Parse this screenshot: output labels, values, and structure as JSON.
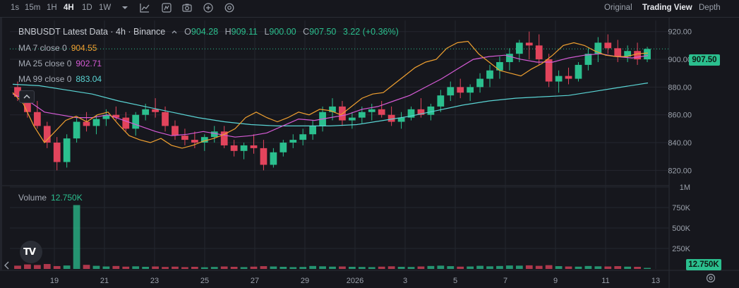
{
  "toolbar": {
    "timeframes": [
      {
        "label": "1s",
        "active": false
      },
      {
        "label": "15m",
        "active": false
      },
      {
        "label": "1H",
        "active": false
      },
      {
        "label": "4H",
        "active": true
      },
      {
        "label": "1D",
        "active": false
      },
      {
        "label": "1W",
        "active": false
      }
    ],
    "icons": [
      "chevron-down-icon",
      "chart-type-icon",
      "indicators-icon",
      "camera-icon",
      "plus-circle-icon",
      "settings-icon"
    ],
    "views": [
      {
        "label": "Original",
        "active": false
      },
      {
        "label": "Trading View",
        "active": true
      },
      {
        "label": "Depth",
        "active": false
      }
    ]
  },
  "header": {
    "pair": "BNBUSDT Latest Data · 4h · Binance",
    "open_label": "O",
    "open": "904.28",
    "high_label": "H",
    "high": "909.11",
    "low_label": "L",
    "low": "900.00",
    "close_label": "C",
    "close": "907.50",
    "change": "3.22 (+0.36%)"
  },
  "indicators": [
    {
      "label": "MA 7 close 0",
      "value": "904.55",
      "color": "#f0a030"
    },
    {
      "label": "MA 25 close 0",
      "value": "902.71",
      "color": "#d65bd6"
    },
    {
      "label": "MA 99 close 0",
      "value": "883.04",
      "color": "#5ad4d4"
    }
  ],
  "volume": {
    "label": "Volume",
    "value": "12.750K",
    "badge": "12.750K"
  },
  "last_price_badge": "907.50",
  "colors": {
    "up": "#2bbf8e",
    "down": "#e2445c",
    "ma7": "#f0a030",
    "ma25": "#d65bd6",
    "ma99": "#5ad4d4",
    "background": "#16171d",
    "grid": "#24272f"
  },
  "chart_data": {
    "type": "candlestick",
    "price_axis_ticks": [
      "920.00",
      "900.00",
      "880.00",
      "860.00",
      "840.00",
      "820.00"
    ],
    "price_ylim": [
      810,
      928
    ],
    "volume_axis_ticks": [
      "1M",
      "750K",
      "500K",
      "250K"
    ],
    "volume_ylim": [
      0,
      1000000
    ],
    "time_axis_ticks": [
      "19",
      "21",
      "23",
      "25",
      "27",
      "29",
      "2026",
      "3",
      "5",
      "7",
      "9",
      "11",
      "13"
    ],
    "ma99_points": [
      [
        0,
        882
      ],
      [
        10,
        881
      ],
      [
        20,
        878
      ],
      [
        30,
        875
      ],
      [
        40,
        870
      ],
      [
        50,
        866
      ],
      [
        60,
        862
      ],
      [
        70,
        858
      ],
      [
        80,
        855
      ],
      [
        90,
        853
      ],
      [
        100,
        852
      ],
      [
        110,
        852
      ],
      [
        120,
        852
      ],
      [
        130,
        853
      ],
      [
        140,
        856
      ],
      [
        150,
        859
      ],
      [
        160,
        863
      ],
      [
        170,
        867
      ],
      [
        180,
        870
      ],
      [
        190,
        872
      ],
      [
        200,
        873
      ],
      [
        210,
        874
      ],
      [
        220,
        877
      ],
      [
        230,
        880
      ],
      [
        240,
        883
      ]
    ],
    "ma25_points": [
      [
        0,
        875
      ],
      [
        6,
        870
      ],
      [
        12,
        862
      ],
      [
        18,
        860
      ],
      [
        24,
        858
      ],
      [
        30,
        858
      ],
      [
        36,
        860
      ],
      [
        42,
        856
      ],
      [
        48,
        852
      ],
      [
        54,
        848
      ],
      [
        60,
        845
      ],
      [
        66,
        846
      ],
      [
        72,
        848
      ],
      [
        78,
        846
      ],
      [
        84,
        844
      ],
      [
        90,
        845
      ],
      [
        96,
        847
      ],
      [
        102,
        852
      ],
      [
        108,
        857
      ],
      [
        114,
        856
      ],
      [
        120,
        858
      ],
      [
        126,
        860
      ],
      [
        132,
        864
      ],
      [
        138,
        866
      ],
      [
        144,
        870
      ],
      [
        150,
        874
      ],
      [
        156,
        880
      ],
      [
        162,
        886
      ],
      [
        168,
        893
      ],
      [
        174,
        900
      ],
      [
        180,
        902
      ],
      [
        186,
        903
      ],
      [
        192,
        900
      ],
      [
        198,
        898
      ],
      [
        204,
        898
      ],
      [
        210,
        901
      ],
      [
        216,
        903
      ],
      [
        222,
        904
      ],
      [
        228,
        902
      ],
      [
        234,
        901
      ],
      [
        240,
        902.7
      ]
    ],
    "ma7_points": [
      [
        0,
        876
      ],
      [
        4,
        868
      ],
      [
        8,
        852
      ],
      [
        12,
        840
      ],
      [
        16,
        848
      ],
      [
        20,
        856
      ],
      [
        24,
        859
      ],
      [
        28,
        855
      ],
      [
        32,
        860
      ],
      [
        36,
        862
      ],
      [
        40,
        853
      ],
      [
        44,
        845
      ],
      [
        48,
        842
      ],
      [
        52,
        840
      ],
      [
        56,
        843
      ],
      [
        60,
        838
      ],
      [
        64,
        836
      ],
      [
        68,
        838
      ],
      [
        72,
        841
      ],
      [
        76,
        843
      ],
      [
        80,
        846
      ],
      [
        84,
        850
      ],
      [
        88,
        858
      ],
      [
        92,
        862
      ],
      [
        96,
        858
      ],
      [
        100,
        855
      ],
      [
        104,
        858
      ],
      [
        108,
        862
      ],
      [
        112,
        860
      ],
      [
        116,
        864
      ],
      [
        120,
        863
      ],
      [
        124,
        860
      ],
      [
        128,
        866
      ],
      [
        132,
        872
      ],
      [
        136,
        875
      ],
      [
        140,
        876
      ],
      [
        144,
        882
      ],
      [
        148,
        888
      ],
      [
        152,
        894
      ],
      [
        156,
        898
      ],
      [
        160,
        900
      ],
      [
        164,
        908
      ],
      [
        168,
        912
      ],
      [
        172,
        913
      ],
      [
        176,
        904
      ],
      [
        180,
        898
      ],
      [
        184,
        892
      ],
      [
        188,
        890
      ],
      [
        192,
        888
      ],
      [
        196,
        893
      ],
      [
        200,
        897
      ],
      [
        204,
        903
      ],
      [
        208,
        910
      ],
      [
        212,
        912
      ],
      [
        216,
        910
      ],
      [
        220,
        906
      ],
      [
        224,
        903
      ],
      [
        228,
        902
      ],
      [
        232,
        902
      ],
      [
        236,
        904
      ],
      [
        240,
        904.55
      ]
    ],
    "candles_ohlc": [
      [
        880,
        884,
        870,
        873
      ],
      [
        873,
        876,
        858,
        862
      ],
      [
        862,
        870,
        850,
        852
      ],
      [
        852,
        855,
        836,
        840
      ],
      [
        840,
        844,
        820,
        826
      ],
      [
        826,
        846,
        822,
        843
      ],
      [
        843,
        858,
        840,
        855
      ],
      [
        855,
        862,
        848,
        852
      ],
      [
        852,
        860,
        846,
        857
      ],
      [
        857,
        864,
        852,
        860
      ],
      [
        860,
        866,
        856,
        858
      ],
      [
        858,
        862,
        848,
        850
      ],
      [
        850,
        862,
        845,
        860
      ],
      [
        860,
        868,
        856,
        864
      ],
      [
        864,
        872,
        858,
        862
      ],
      [
        862,
        866,
        848,
        852
      ],
      [
        852,
        856,
        842,
        845
      ],
      [
        845,
        850,
        838,
        842
      ],
      [
        842,
        848,
        836,
        840
      ],
      [
        840,
        846,
        834,
        844
      ],
      [
        844,
        852,
        840,
        848
      ],
      [
        848,
        852,
        836,
        838
      ],
      [
        838,
        842,
        830,
        834
      ],
      [
        834,
        840,
        828,
        838
      ],
      [
        838,
        846,
        832,
        836
      ],
      [
        836,
        842,
        820,
        824
      ],
      [
        824,
        836,
        822,
        833
      ],
      [
        833,
        842,
        830,
        840
      ],
      [
        840,
        846,
        836,
        842
      ],
      [
        842,
        850,
        838,
        846
      ],
      [
        846,
        856,
        842,
        852
      ],
      [
        852,
        866,
        848,
        862
      ],
      [
        862,
        872,
        856,
        866
      ],
      [
        866,
        870,
        852,
        856
      ],
      [
        856,
        862,
        850,
        858
      ],
      [
        858,
        866,
        854,
        862
      ],
      [
        862,
        868,
        856,
        864
      ],
      [
        864,
        870,
        858,
        860
      ],
      [
        860,
        866,
        852,
        855
      ],
      [
        855,
        862,
        850,
        858
      ],
      [
        858,
        866,
        856,
        864
      ],
      [
        864,
        872,
        858,
        860
      ],
      [
        860,
        868,
        856,
        866
      ],
      [
        866,
        878,
        862,
        874
      ],
      [
        874,
        884,
        870,
        880
      ],
      [
        880,
        886,
        872,
        876
      ],
      [
        876,
        882,
        870,
        880
      ],
      [
        880,
        890,
        876,
        886
      ],
      [
        886,
        896,
        880,
        892
      ],
      [
        892,
        902,
        886,
        898
      ],
      [
        898,
        908,
        892,
        904
      ],
      [
        904,
        914,
        898,
        912
      ],
      [
        912,
        920,
        900,
        910
      ],
      [
        910,
        918,
        896,
        900
      ],
      [
        900,
        904,
        880,
        884
      ],
      [
        884,
        892,
        876,
        888
      ],
      [
        888,
        894,
        882,
        886
      ],
      [
        886,
        898,
        884,
        896
      ],
      [
        896,
        908,
        892,
        904
      ],
      [
        904,
        916,
        898,
        912
      ],
      [
        912,
        918,
        904,
        908
      ],
      [
        908,
        914,
        898,
        902
      ],
      [
        902,
        910,
        898,
        906
      ],
      [
        906,
        912,
        896,
        900
      ],
      [
        900,
        909,
        898,
        907.5
      ]
    ],
    "volume_values": [
      40000,
      55000,
      48000,
      60000,
      35000,
      42000,
      780000,
      50000,
      38000,
      30000,
      36000,
      28000,
      32000,
      26000,
      30000,
      24000,
      28000,
      22000,
      26000,
      20000,
      24000,
      30000,
      26000,
      22000,
      28000,
      34000,
      30000,
      26000,
      22000,
      24000,
      36000,
      32000,
      28000,
      30000,
      26000,
      24000,
      22000,
      28000,
      32000,
      26000,
      24000,
      30000,
      36000,
      40000,
      34000,
      28000,
      30000,
      38000,
      32000,
      36000,
      42000,
      40000,
      44000,
      38000,
      46000,
      34000,
      30000,
      28000,
      36000,
      32000,
      30000,
      34000,
      28000,
      26000,
      12750
    ]
  }
}
